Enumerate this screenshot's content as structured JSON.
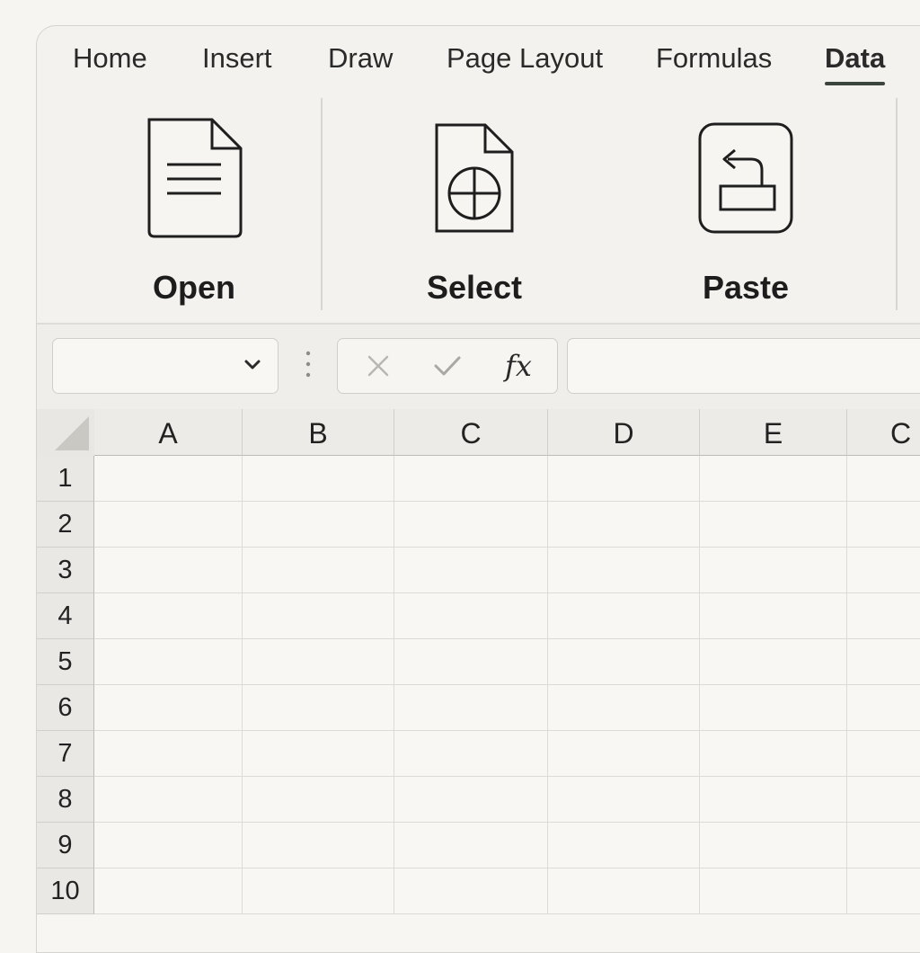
{
  "ribbon": {
    "tabs": [
      "Home",
      "Insert",
      "Draw",
      "Page Layout",
      "Formulas",
      "Data"
    ],
    "active_tab": "Data",
    "buttons": [
      {
        "label": "Open",
        "icon": "document-icon"
      },
      {
        "label": "Select",
        "icon": "document-crosshair-icon"
      },
      {
        "label": "Paste",
        "icon": "paste-return-icon"
      }
    ]
  },
  "formula_bar": {
    "name_box_value": "",
    "cancel_icon": "close-icon",
    "enter_icon": "checkmark-icon",
    "fx_label": "fx",
    "formula_value": ""
  },
  "grid": {
    "columns": [
      "A",
      "B",
      "C",
      "D",
      "E",
      "C"
    ],
    "rows": [
      "1",
      "2",
      "3",
      "4",
      "5",
      "6",
      "7",
      "8",
      "9",
      "10"
    ]
  }
}
